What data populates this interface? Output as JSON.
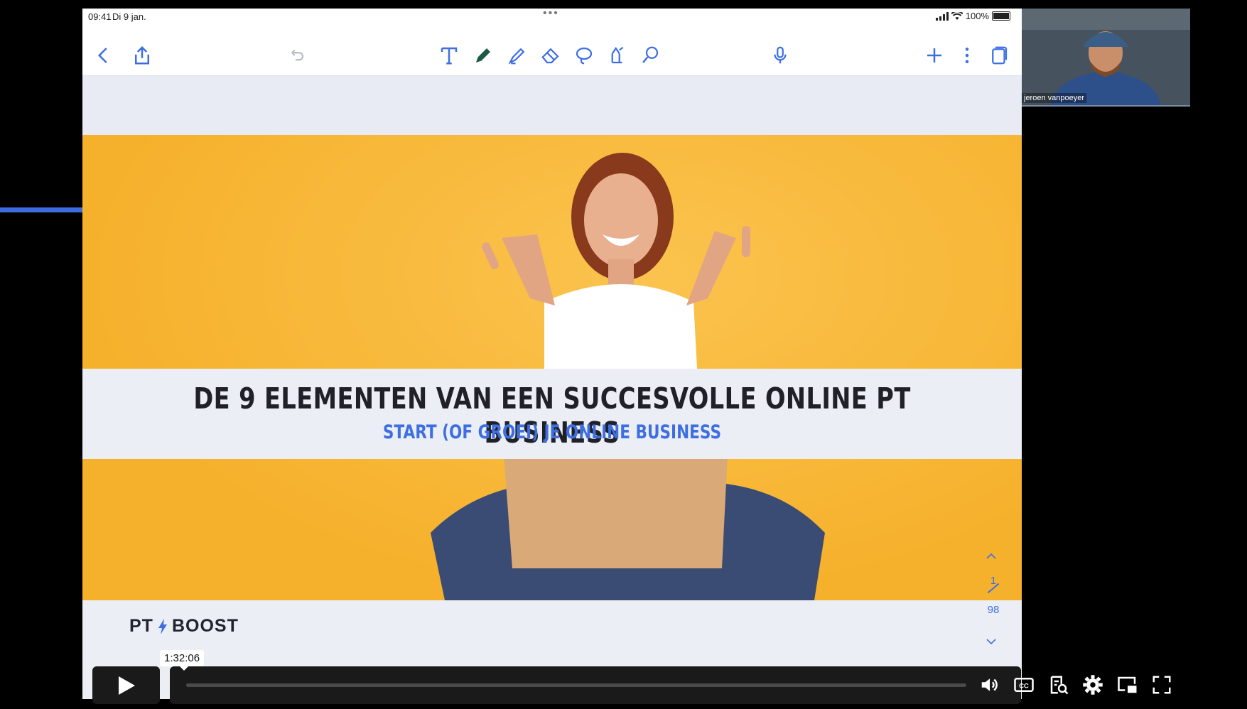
{
  "status_bar": {
    "time": "09:41",
    "date": "Di 9 jan.",
    "battery": "100%"
  },
  "toolbar": {
    "left_icons": [
      "back-chevron-icon",
      "share-icon",
      "undo-icon"
    ],
    "tools": [
      "text-tool-icon",
      "pen-icon",
      "highlighter-icon",
      "eraser-icon",
      "lasso-icon",
      "shapes-icon",
      "elements-icon"
    ],
    "right_icons": [
      "microphone-icon",
      "add-icon",
      "more-icon",
      "pages-icon"
    ]
  },
  "slide": {
    "title": "DE 9 ELEMENTEN VAN EEN SUCCESVOLLE ONLINE PT BUSINESS",
    "subtitle": "START (OF GROEI) JE ONLINE BUSINESS",
    "brand_left": "PT",
    "brand_right": "BOOST",
    "background_color": "#f7b733"
  },
  "pagination": {
    "current": "1",
    "total": "98"
  },
  "webcam": {
    "participant_name": "jeroen vanpoeyer"
  },
  "player": {
    "hover_time": "1:32:06",
    "progress": 0,
    "controls": [
      "volume-icon",
      "captions-icon",
      "transcript-icon",
      "settings-icon",
      "picture-in-picture-icon",
      "fullscreen-icon"
    ]
  },
  "colors": {
    "accent": "#3d6fe3",
    "slide_bg": "#f7b733"
  }
}
